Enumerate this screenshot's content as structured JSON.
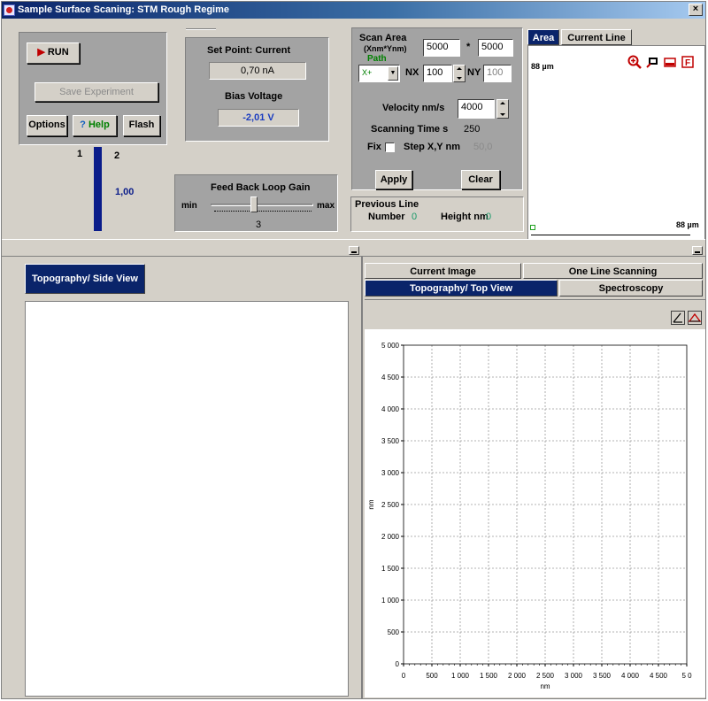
{
  "window": {
    "title": "Sample Surface Scaning: STM Rough Regime",
    "close_label": "×"
  },
  "controls": {
    "run_label": "RUN",
    "save_label": "Save Experiment",
    "options_label": "Options",
    "help_label": "Help",
    "flash_label": "Flash"
  },
  "indicator": {
    "tick1": "1",
    "tick2": "2",
    "value": "1,00"
  },
  "setpoint": {
    "title": "Set Point: Current",
    "value": "0,70 nA",
    "bias_title": "Bias Voltage",
    "bias_value": "-2,01 V"
  },
  "feedback": {
    "title": "Feed Back Loop Gain",
    "min": "min",
    "max": "max",
    "value": "3",
    "level_fraction": 0.42
  },
  "scan": {
    "area_label": "Scan Area",
    "area_unit": "(Xnm*Ynm)",
    "x_value": "5000",
    "times": "*",
    "y_value": "5000",
    "path_label": "Path",
    "path_value": "X+",
    "nx_label": "NX",
    "nx_value": "100",
    "ny_label": "NY",
    "ny_value": "100",
    "velocity_label": "Velocity nm/s",
    "velocity_value": "4000",
    "scanning_time_label": "Scanning Time s",
    "scanning_time_value": "250",
    "fix_label": "Fix",
    "step_label": "Step X,Y nm",
    "step_value": "50,0",
    "apply_label": "Apply",
    "clear_label": "Clear",
    "prev_line_label": "Previous Line",
    "number_label": "Number",
    "number_value": "0",
    "height_label": "Height nm",
    "height_value": "0"
  },
  "area_view": {
    "tabs": [
      "Area",
      "Current Line"
    ],
    "top_label": "88 µm",
    "right_label": "88 µm"
  },
  "left_pane": {
    "tab": "Topography/ Side View"
  },
  "right_pane": {
    "tabs_row1": [
      "Current Image",
      "One Line Scanning"
    ],
    "tabs_row2": [
      "Topography/ Top View",
      "Spectroscopy"
    ]
  },
  "chart_data": {
    "type": "heatmap",
    "xlabel": "nm",
    "ylabel": "nm",
    "xlim": [
      0,
      5000
    ],
    "ylim": [
      0,
      5000
    ],
    "grid": true,
    "x_ticks": [
      "0",
      "500",
      "1 000",
      "1 500",
      "2 000",
      "2 500",
      "3 000",
      "3 500",
      "4 000",
      "4 500",
      "5 0"
    ],
    "y_ticks": [
      "0",
      "500",
      "1 000",
      "1 500",
      "2 000",
      "2 500",
      "3 000",
      "3 500",
      "4 000",
      "4 500",
      "5 000"
    ],
    "values": []
  }
}
